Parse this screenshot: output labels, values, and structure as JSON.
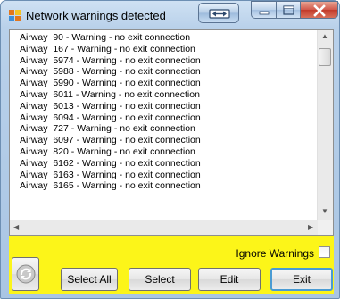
{
  "window": {
    "title": "Network warnings detected",
    "title_bar_color": "#b9d1ea",
    "panel_color": "#fcf519"
  },
  "icons": {
    "app": "app-icon",
    "restore_ext": "resize-arrows-icon",
    "minimize": "minimize-icon",
    "maximize": "maximize-icon",
    "close": "close-icon",
    "refresh": "refresh-icon"
  },
  "warnings": [
    "Airway  90 - Warning - no exit connection",
    "Airway  167 - Warning - no exit connection",
    "Airway  5974 - Warning - no exit connection",
    "Airway  5988 - Warning - no exit connection",
    "Airway  5990 - Warning - no exit connection",
    "Airway  6011 - Warning - no exit connection",
    "Airway  6013 - Warning - no exit connection",
    "Airway  6094 - Warning - no exit connection",
    "Airway  727 - Warning - no exit connection",
    "Airway  6097 - Warning - no exit connection",
    "Airway  820 - Warning - no exit connection",
    "Airway  6162 - Warning - no exit connection",
    "Airway  6163 - Warning - no exit connection",
    "Airway  6165 - Warning - no exit connection"
  ],
  "ignore_warnings": {
    "label": "Ignore Warnings",
    "checked": false
  },
  "buttons": {
    "select_all": "Select All",
    "select": "Select",
    "edit": "Edit",
    "exit": "Exit"
  }
}
